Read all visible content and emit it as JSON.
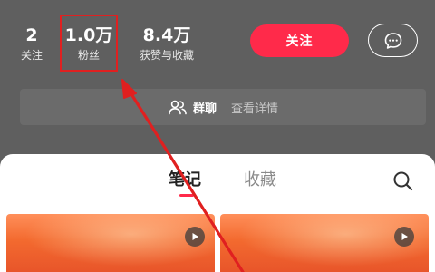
{
  "stats": {
    "following": {
      "value": "2",
      "label": "关注"
    },
    "fans": {
      "value": "1.0万",
      "label": "粉丝"
    },
    "likes": {
      "value": "8.4万",
      "label": "获赞与收藏"
    }
  },
  "actions": {
    "follow_label": "关注",
    "chat_icon": "chat-bubble-icon"
  },
  "group_chat": {
    "icon": "people-icon",
    "label": "群聊",
    "detail": "查看详情"
  },
  "tabs": [
    {
      "label": "笔记",
      "active": true
    },
    {
      "label": "收藏",
      "active": false
    }
  ],
  "colors": {
    "accent": "#ff2a4a",
    "annotation": "#e02020",
    "background": "#5f5f5f"
  },
  "annotation": {
    "highlight_target": "fans"
  }
}
